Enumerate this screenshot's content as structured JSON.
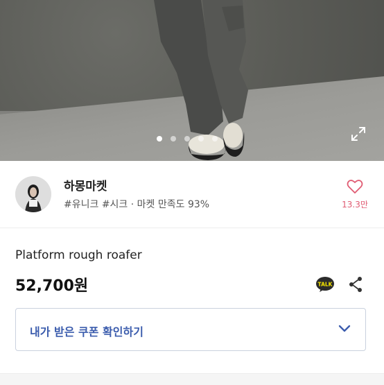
{
  "gallery": {
    "slide_count": 5,
    "active_index": 0,
    "icons": {
      "expand": "expand-icon"
    }
  },
  "seller": {
    "name": "하몽마켓",
    "tags": "#유니크 #시크 · 마켓 만족도 93%",
    "like_count": "13.3만",
    "icons": {
      "like": "heart-icon",
      "avatar": "avatar"
    }
  },
  "product": {
    "title": "Platform rough roafer",
    "price": "52,700원",
    "icons": {
      "talk": "kakaotalk-icon",
      "share": "share-icon"
    }
  },
  "coupon": {
    "label": "내가 받은 쿠폰 확인하기",
    "icons": {
      "toggle": "chevron-down-icon"
    }
  },
  "colors": {
    "coupon_text": "#3b5cad",
    "like_accent": "#e05c73",
    "talk_badge": "#2b2b2b"
  }
}
